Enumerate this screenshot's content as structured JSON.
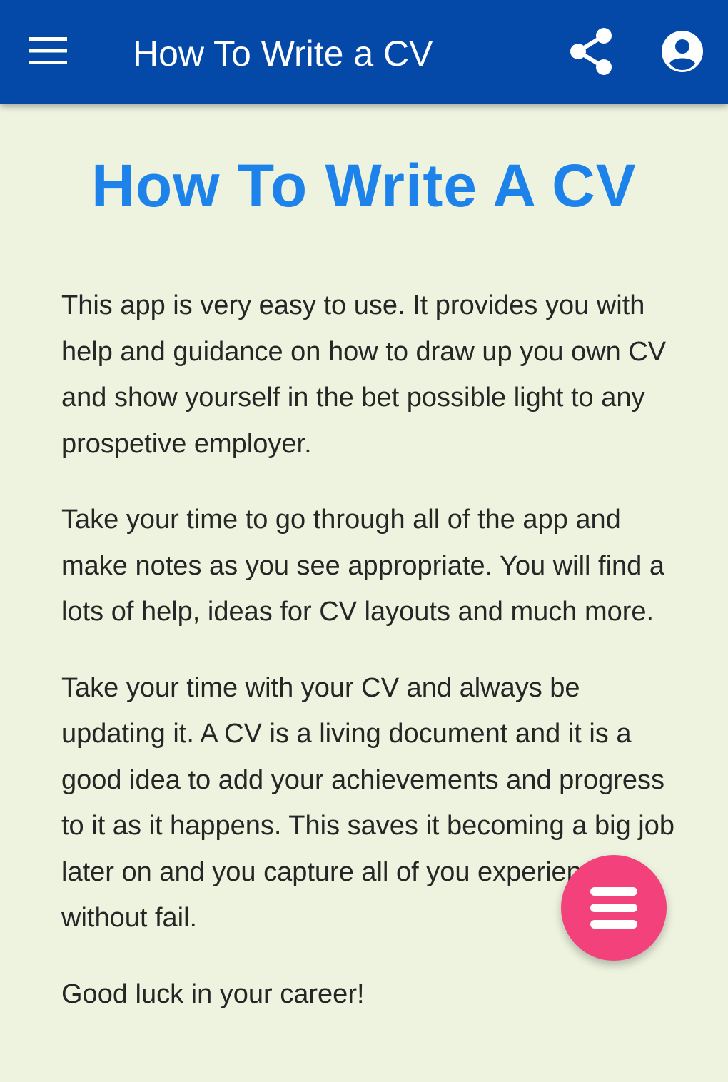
{
  "app_bar": {
    "title": "How To Write a CV",
    "icons": {
      "menu": "menu-icon",
      "share": "share-icon",
      "account": "account-circle-icon"
    },
    "background_color": "#0449a8"
  },
  "content": {
    "heading": "How To Write A CV",
    "heading_color": "#1d83ea",
    "paragraphs": [
      "This app is very easy to use. It provides you with help and guidance on how to draw up you own CV and show yourself in the bet possible light to any prospetive employer.",
      "Take your time to go through all of the app and make notes as you see appropriate. You will find a lots of help, ideas for CV layouts and much more.",
      "Take your time with your CV and always be updating it. A CV is a living document and it is a good idea to add your achievements and progress to it as it happens. This saves it becoming a big job later on and you capture all of you experience without fail.",
      "Good luck in your career!"
    ],
    "background_color": "#edf3df"
  },
  "fab": {
    "icon": "menu-icon",
    "color": "#f2417b"
  }
}
